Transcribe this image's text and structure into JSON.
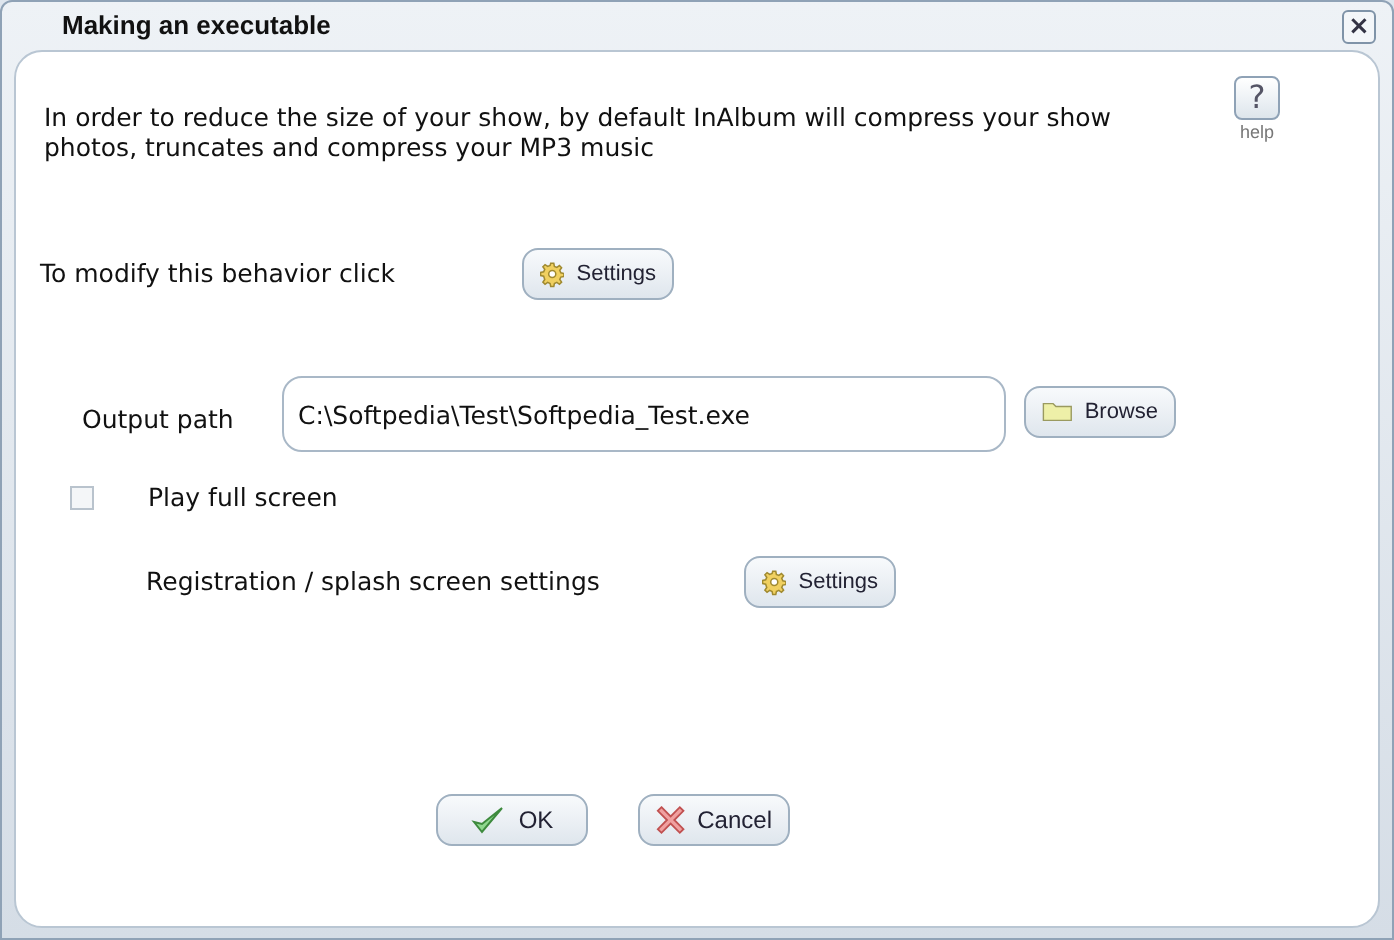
{
  "window": {
    "title": "Making an executable",
    "close": "×"
  },
  "intro": "In order to reduce the size of your show, by default InAlbum will compress your show photos, truncates and compress your MP3 music",
  "help": {
    "icon": "?",
    "label": "help"
  },
  "modify": {
    "label": "To modify this behavior click",
    "button": "Settings"
  },
  "output": {
    "label": "Output path",
    "value": "C:\\Softpedia\\Test\\Softpedia_Test.exe",
    "button": "Browse"
  },
  "fullscreen": {
    "label": "Play full screen",
    "checked": false
  },
  "registration": {
    "label": "Registration  / splash screen settings",
    "button": "Settings"
  },
  "buttons": [
    {
      "kind": "ok",
      "label": "OK"
    },
    {
      "kind": "cancel",
      "label": "Cancel"
    }
  ]
}
